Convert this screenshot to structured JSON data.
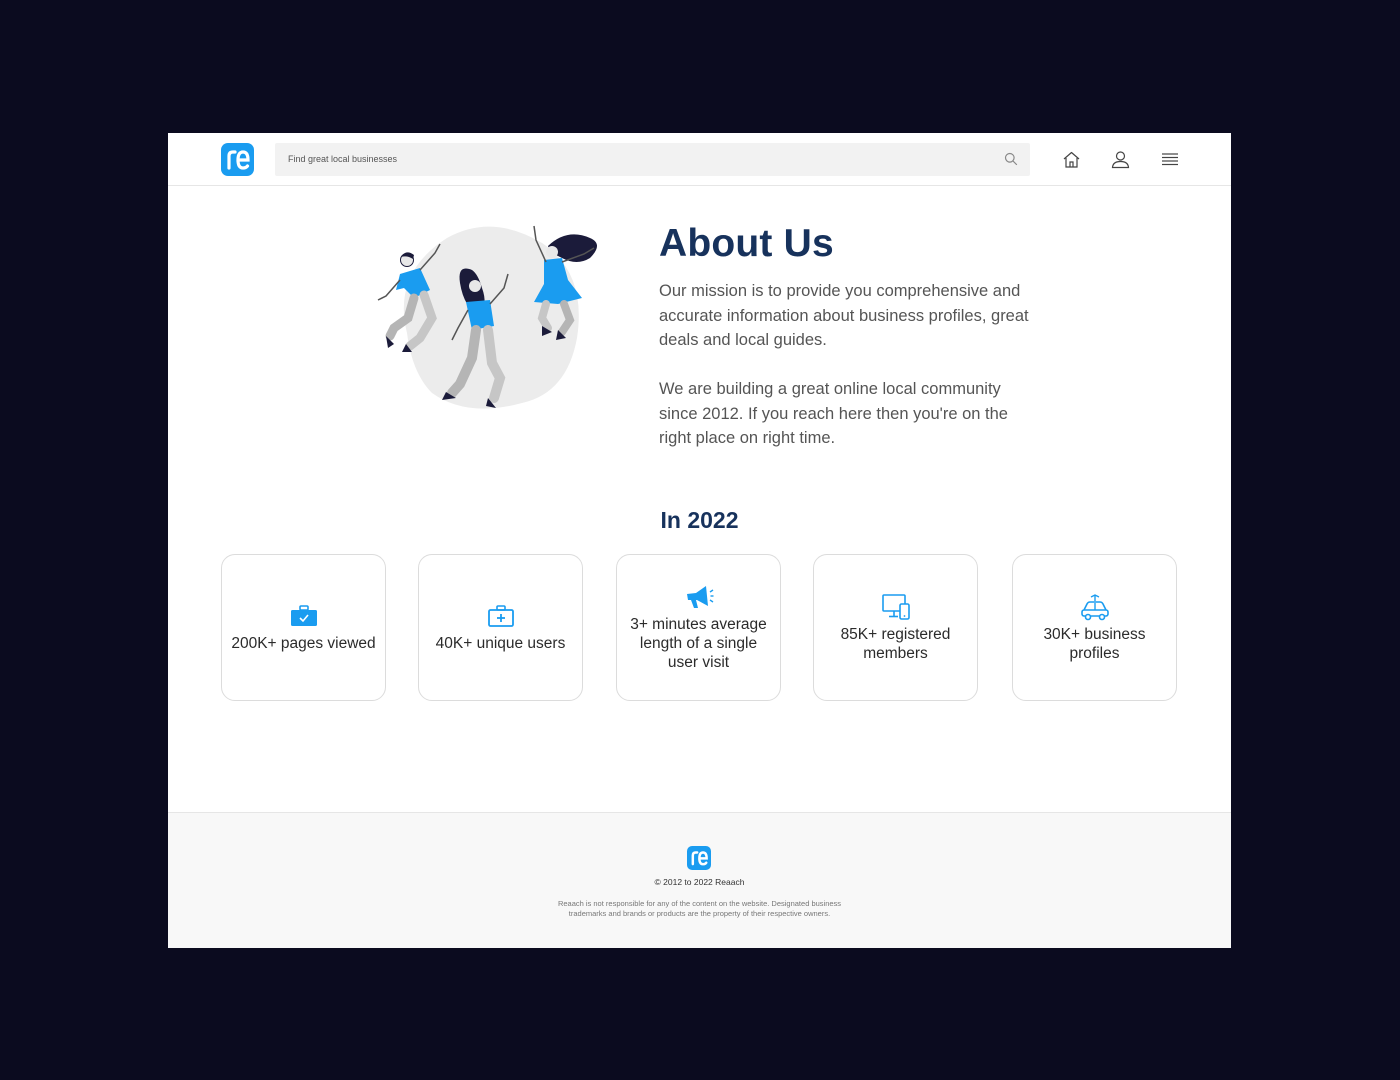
{
  "header": {
    "search_placeholder": "Find great local businesses",
    "icons": [
      "home-icon",
      "user-icon",
      "menu-icon"
    ]
  },
  "about": {
    "title": "About Us",
    "paragraph1": "Our mission is to provide you comprehensive and accurate information about business profiles, great deals and local guides.",
    "paragraph2": "We are building a great online local community since 2012. If you reach here then you're on the right place on right time."
  },
  "stats": {
    "title": "In 2022",
    "cards": [
      {
        "icon": "briefcase-check-icon",
        "label": "200K+ pages viewed"
      },
      {
        "icon": "medical-kit-icon",
        "label": "40K+ unique users"
      },
      {
        "icon": "megaphone-icon",
        "label": "3+ minutes average length of a single user visit"
      },
      {
        "icon": "devices-icon",
        "label": "85K+ registered members"
      },
      {
        "icon": "car-icon",
        "label": "30K+ business profiles"
      }
    ]
  },
  "footer": {
    "copyright": "© 2012 to 2022 Reaach",
    "disclaimer": "Reaach is not responsible for any of the content on the website. Designated business trademarks and brands or products are the property of their respective owners."
  },
  "colors": {
    "accent": "#1a9cf0",
    "heading": "#17325c",
    "background": "#0b0b1f"
  }
}
